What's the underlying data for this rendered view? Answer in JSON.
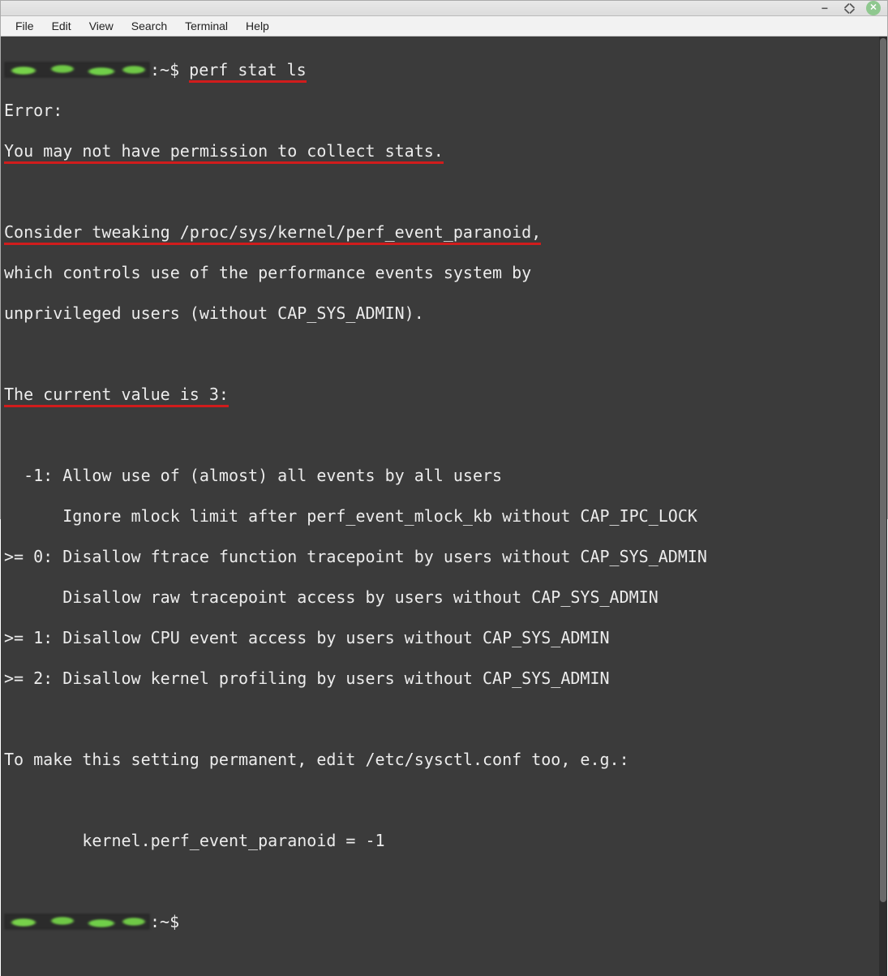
{
  "menu": {
    "file": "File",
    "edit": "Edit",
    "view": "View",
    "search": "Search",
    "terminal": "Terminal",
    "help": "Help"
  },
  "prompt": {
    "sep": ":~$ ",
    "command": "perf stat ls"
  },
  "out": {
    "l1": "Error:",
    "l2": "You may not have permission to collect stats.",
    "l3": "",
    "l4": "Consider tweaking /proc/sys/kernel/perf_event_paranoid,",
    "l5": "which controls use of the performance events system by",
    "l6": "unprivileged users (without CAP_SYS_ADMIN).",
    "l7": "",
    "l8": "The current value is 3:",
    "l9": "",
    "l10": "  -1: Allow use of (almost) all events by all users",
    "l11": "      Ignore mlock limit after perf_event_mlock_kb without CAP_IPC_LOCK",
    "l12": ">= 0: Disallow ftrace function tracepoint by users without CAP_SYS_ADMIN",
    "l13": "      Disallow raw tracepoint access by users without CAP_SYS_ADMIN",
    "l14": ">= 1: Disallow CPU event access by users without CAP_SYS_ADMIN",
    "l15": ">= 2: Disallow kernel profiling by users without CAP_SYS_ADMIN",
    "l16": "",
    "l17": "To make this setting permanent, edit /etc/sysctl.conf too, e.g.:",
    "l18": "",
    "l19": "        kernel.perf_event_paranoid = -1",
    "l20": ""
  },
  "prompt2": {
    "sep": ":~$ "
  },
  "colors": {
    "terminal_bg": "#3b3b3b",
    "terminal_fg": "#ececec",
    "underline": "#d11c1c",
    "prompt_green": "#77d24a",
    "close_btn": "#8fc88f"
  }
}
